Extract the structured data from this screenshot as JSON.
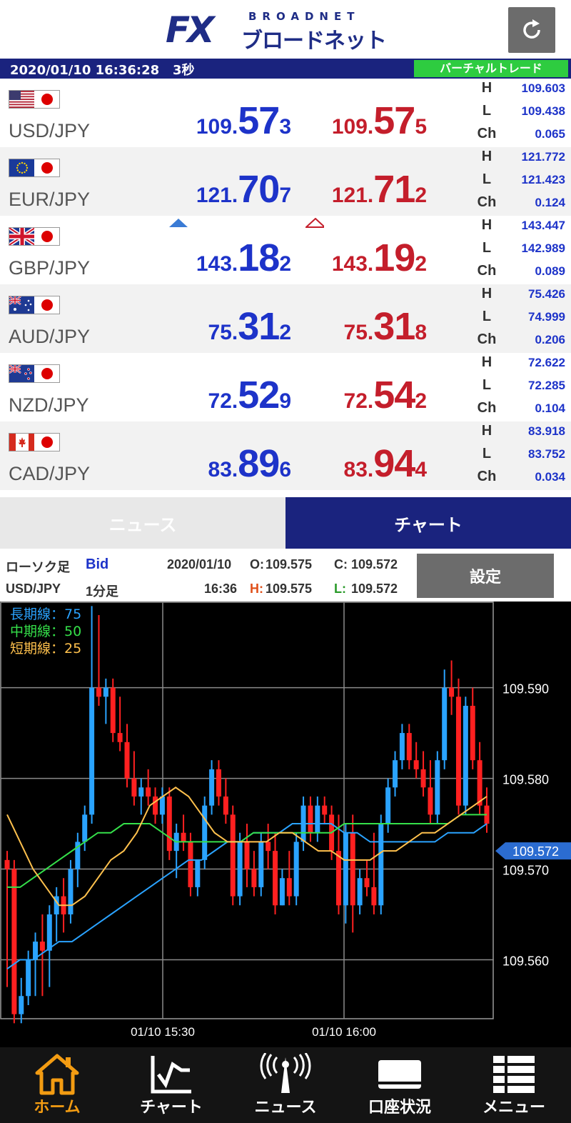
{
  "header": {
    "logo_fx": "FX",
    "logo_broadnet": "BROADNET",
    "logo_jp": "ブロードネット"
  },
  "status": {
    "datetime": "2020/01/10 16:36:28",
    "interval": "3秒",
    "mode": "バーチャルトレード"
  },
  "rates": [
    {
      "pair": "USD/JPY",
      "flag": "us-flag-icon",
      "bid": {
        "p1": "109.",
        "p2": "57",
        "p3": "3"
      },
      "ask": {
        "p1": "109.",
        "p2": "57",
        "p3": "5"
      },
      "H": "109.603",
      "L": "109.438",
      "Ch": "0.065"
    },
    {
      "pair": "EUR/JPY",
      "flag": "eu-flag-icon",
      "bid": {
        "p1": "121.",
        "p2": "70",
        "p3": "7"
      },
      "ask": {
        "p1": "121.",
        "p2": "71",
        "p3": "2"
      },
      "H": "121.772",
      "L": "121.423",
      "Ch": "0.124"
    },
    {
      "pair": "GBP/JPY",
      "flag": "uk-flag-icon",
      "bid": {
        "p1": "143.",
        "p2": "18",
        "p3": "2"
      },
      "ask": {
        "p1": "143.",
        "p2": "19",
        "p3": "2"
      },
      "H": "143.447",
      "L": "142.989",
      "Ch": "0.089"
    },
    {
      "pair": "AUD/JPY",
      "flag": "au-flag-icon",
      "bid": {
        "p1": "75.",
        "p2": "31",
        "p3": "2"
      },
      "ask": {
        "p1": "75.",
        "p2": "31",
        "p3": "8"
      },
      "H": "75.426",
      "L": "74.999",
      "Ch": "0.206"
    },
    {
      "pair": "NZD/JPY",
      "flag": "nz-flag-icon",
      "bid": {
        "p1": "72.",
        "p2": "52",
        "p3": "9"
      },
      "ask": {
        "p1": "72.",
        "p2": "54",
        "p3": "2"
      },
      "H": "72.622",
      "L": "72.285",
      "Ch": "0.104"
    },
    {
      "pair": "CAD/JPY",
      "flag": "ca-flag-icon",
      "bid": {
        "p1": "83.",
        "p2": "89",
        "p3": "6"
      },
      "ask": {
        "p1": "83.",
        "p2": "94",
        "p3": "4"
      },
      "H": "83.918",
      "L": "83.752",
      "Ch": "0.034"
    }
  ],
  "hl_labels": {
    "h": "H",
    "l": "L",
    "ch": "Ch"
  },
  "tabs": {
    "news": "ニュース",
    "chart": "チャート"
  },
  "chart_info": {
    "candle_label": "ローソク足",
    "price_type": "Bid",
    "date": "2020/01/10",
    "time": "16:36",
    "pair": "USD/JPY",
    "timeframe": "1分足",
    "o_label": "O:",
    "o_value": "109.575",
    "c_label": "C:",
    "c_value": "109.572",
    "h_label": "H:",
    "h_value": "109.575",
    "l_label": "L:",
    "l_value": "109.572",
    "settings": "設定"
  },
  "chart_data": {
    "type": "candlestick",
    "legend": [
      {
        "name": "長期線：75",
        "color": "#2aa3ff"
      },
      {
        "name": "中期線：50",
        "color": "#35e04a"
      },
      {
        "name": "短期線：25",
        "color": "#ffc14d"
      }
    ],
    "y_ticks": [
      "109.590",
      "109.580",
      "109.570",
      "109.560"
    ],
    "y_tick_values": [
      109.59,
      109.58,
      109.57,
      109.56
    ],
    "ylim": [
      109.5535,
      109.5995
    ],
    "x_ticks": [
      "01/10 15:30",
      "01/10 16:00"
    ],
    "current_price": "109.572",
    "up_color": "#2aa3ff",
    "down_color": "#ff2020",
    "candles": [
      [
        109.571,
        109.572,
        109.557,
        109.57
      ],
      [
        109.57,
        109.571,
        109.553,
        109.554
      ],
      [
        109.554,
        109.558,
        109.553,
        109.556
      ],
      [
        109.556,
        109.561,
        109.555,
        109.56
      ],
      [
        109.56,
        109.563,
        109.556,
        109.562
      ],
      [
        109.562,
        109.565,
        109.556,
        109.561
      ],
      [
        109.561,
        109.566,
        109.557,
        109.565
      ],
      [
        109.565,
        109.568,
        109.562,
        109.567
      ],
      [
        109.567,
        109.569,
        109.563,
        109.565
      ],
      [
        109.565,
        109.571,
        109.564,
        109.57
      ],
      [
        109.57,
        109.574,
        109.568,
        109.573
      ],
      [
        109.573,
        109.577,
        109.572,
        109.576
      ],
      [
        109.576,
        109.599,
        109.575,
        109.59
      ],
      [
        109.59,
        109.598,
        109.588,
        109.589
      ],
      [
        109.589,
        109.591,
        109.586,
        109.59
      ],
      [
        109.59,
        109.591,
        109.584,
        109.585
      ],
      [
        109.585,
        109.589,
        109.583,
        109.584
      ],
      [
        109.584,
        109.586,
        109.579,
        109.58
      ],
      [
        109.58,
        109.583,
        109.577,
        109.578
      ],
      [
        109.578,
        109.58,
        109.576,
        109.579
      ],
      [
        109.579,
        109.581,
        109.577,
        109.578
      ],
      [
        109.578,
        109.579,
        109.575,
        109.576
      ],
      [
        109.576,
        109.579,
        109.575,
        109.578
      ],
      [
        109.578,
        109.579,
        109.571,
        109.572
      ],
      [
        109.572,
        109.575,
        109.569,
        109.574
      ],
      [
        109.574,
        109.576,
        109.572,
        109.573
      ],
      [
        109.573,
        109.574,
        109.567,
        109.568
      ],
      [
        109.568,
        109.571,
        109.567,
        109.571
      ],
      [
        109.571,
        109.578,
        109.57,
        109.577
      ],
      [
        109.577,
        109.582,
        109.576,
        109.581
      ],
      [
        109.581,
        109.582,
        109.577,
        109.578
      ],
      [
        109.578,
        109.58,
        109.575,
        109.576
      ],
      [
        109.576,
        109.577,
        109.566,
        109.567
      ],
      [
        109.567,
        109.574,
        109.566,
        109.573
      ],
      [
        109.573,
        109.575,
        109.568,
        109.57
      ],
      [
        109.57,
        109.572,
        109.567,
        109.568
      ],
      [
        109.568,
        109.574,
        109.567,
        109.573
      ],
      [
        109.573,
        109.575,
        109.57,
        109.572
      ],
      [
        109.572,
        109.574,
        109.565,
        109.566
      ],
      [
        109.566,
        109.57,
        109.566,
        109.569
      ],
      [
        109.569,
        109.572,
        109.566,
        109.567
      ],
      [
        109.567,
        109.574,
        109.566,
        109.573
      ],
      [
        109.573,
        109.578,
        109.572,
        109.577
      ],
      [
        109.577,
        109.578,
        109.573,
        109.574
      ],
      [
        109.574,
        109.578,
        109.573,
        109.577
      ],
      [
        109.577,
        109.578,
        109.575,
        109.576
      ],
      [
        109.576,
        109.577,
        109.571,
        109.572
      ],
      [
        109.572,
        109.576,
        109.565,
        109.566
      ],
      [
        109.566,
        109.575,
        109.564,
        109.574
      ],
      [
        109.574,
        109.576,
        109.563,
        109.566
      ],
      [
        109.566,
        109.57,
        109.565,
        109.569
      ],
      [
        109.569,
        109.571,
        109.567,
        109.568
      ],
      [
        109.568,
        109.574,
        109.565,
        109.566
      ],
      [
        109.566,
        109.576,
        109.565,
        109.575
      ],
      [
        109.575,
        109.58,
        109.574,
        109.579
      ],
      [
        109.579,
        109.583,
        109.578,
        109.582
      ],
      [
        109.582,
        109.586,
        109.581,
        109.585
      ],
      [
        109.585,
        109.586,
        109.581,
        109.582
      ],
      [
        109.582,
        109.584,
        109.58,
        109.581
      ],
      [
        109.581,
        109.583,
        109.578,
        109.579
      ],
      [
        109.579,
        109.582,
        109.575,
        109.576
      ],
      [
        109.576,
        109.583,
        109.575,
        109.582
      ],
      [
        109.582,
        109.592,
        109.581,
        109.59
      ],
      [
        109.59,
        109.593,
        109.587,
        109.589
      ],
      [
        109.589,
        109.591,
        109.576,
        109.577
      ],
      [
        109.577,
        109.589,
        109.576,
        109.588
      ],
      [
        109.588,
        109.59,
        109.581,
        109.582
      ],
      [
        109.582,
        109.584,
        109.576,
        109.577
      ],
      [
        109.577,
        109.579,
        109.574,
        109.575
      ]
    ],
    "ma_long": [
      109.559,
      109.56,
      109.56,
      109.561,
      109.562,
      109.562,
      109.563,
      109.564,
      109.565,
      109.566,
      109.567,
      109.568,
      109.569,
      109.57,
      109.571,
      109.571,
      109.572,
      109.573,
      109.573,
      109.574,
      109.574,
      109.574,
      109.575,
      109.575,
      109.575,
      109.575,
      109.574,
      109.574,
      109.573,
      109.573,
      109.573,
      109.573,
      109.573,
      109.573,
      109.574,
      109.574,
      109.574,
      109.575
    ],
    "ma_mid": [
      109.568,
      109.568,
      109.569,
      109.57,
      109.571,
      109.572,
      109.573,
      109.574,
      109.574,
      109.575,
      109.575,
      109.575,
      109.574,
      109.573,
      109.573,
      109.573,
      109.573,
      109.573,
      109.573,
      109.574,
      109.574,
      109.574,
      109.574,
      109.574,
      109.574,
      109.574,
      109.575,
      109.575,
      109.575,
      109.575,
      109.575,
      109.575,
      109.575,
      109.575,
      109.575,
      109.576,
      109.576,
      109.576
    ],
    "ma_short": [
      109.576,
      109.573,
      109.57,
      109.568,
      109.566,
      109.566,
      109.567,
      109.569,
      109.571,
      109.572,
      109.574,
      109.577,
      109.578,
      109.579,
      109.578,
      109.576,
      109.574,
      109.573,
      109.573,
      109.573,
      109.573,
      109.574,
      109.574,
      109.573,
      109.572,
      109.572,
      109.571,
      109.571,
      109.571,
      109.572,
      109.572,
      109.573,
      109.574,
      109.574,
      109.575,
      109.576,
      109.577,
      109.578
    ]
  },
  "bottomnav": [
    {
      "label": "ホーム",
      "icon": "home-icon",
      "active": true
    },
    {
      "label": "チャート",
      "icon": "chart-icon",
      "active": false
    },
    {
      "label": "ニュース",
      "icon": "news-antenna-icon",
      "active": false
    },
    {
      "label": "口座状況",
      "icon": "account-card-icon",
      "active": false
    },
    {
      "label": "メニュー",
      "icon": "menu-grid-icon",
      "active": false
    }
  ]
}
